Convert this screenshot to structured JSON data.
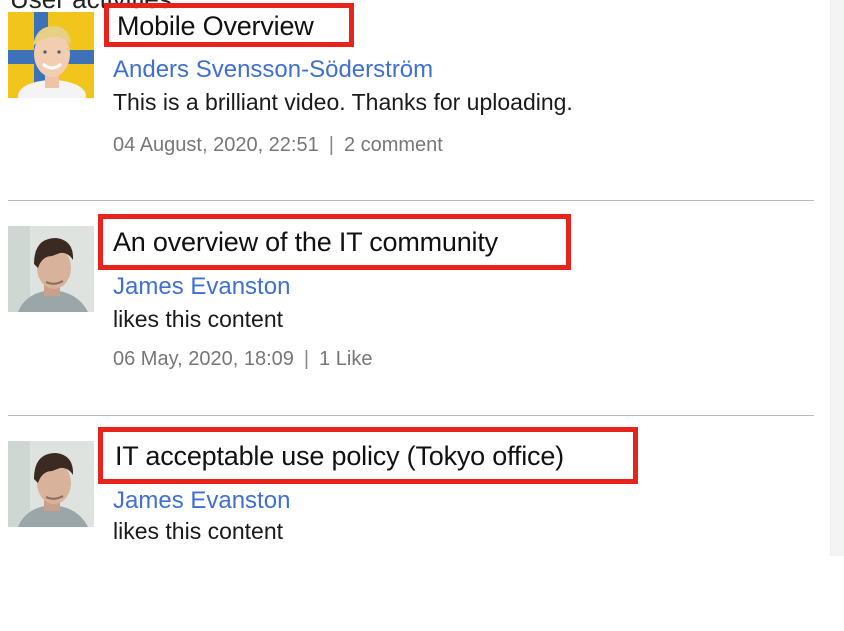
{
  "section": {
    "heading": "User activities"
  },
  "activities": [
    {
      "title": "Mobile Overview",
      "author": "Anders Svensson-Söderström",
      "body": "This is a brilliant video. Thanks for uploading.",
      "timestamp": "04 August, 2020, 22:51",
      "separator": "|",
      "count_label": "2 comment",
      "avatar": "avatar-blond-man-yellow-background"
    },
    {
      "title": "An overview of the IT community",
      "author": "James Evanston",
      "body": "likes this content",
      "timestamp": "06 May, 2020, 18:09",
      "separator": "|",
      "count_label": "1 Like",
      "avatar": "avatar-dark-haired-man"
    },
    {
      "title": "IT acceptable use policy (Tokyo office)",
      "author": "James Evanston",
      "body": "likes this content",
      "avatar": "avatar-dark-haired-man"
    }
  ],
  "colors": {
    "highlight_border": "#e8231b",
    "author_link": "#3f6fd6",
    "meta_text": "#777777",
    "divider": "#b9b9b9"
  }
}
